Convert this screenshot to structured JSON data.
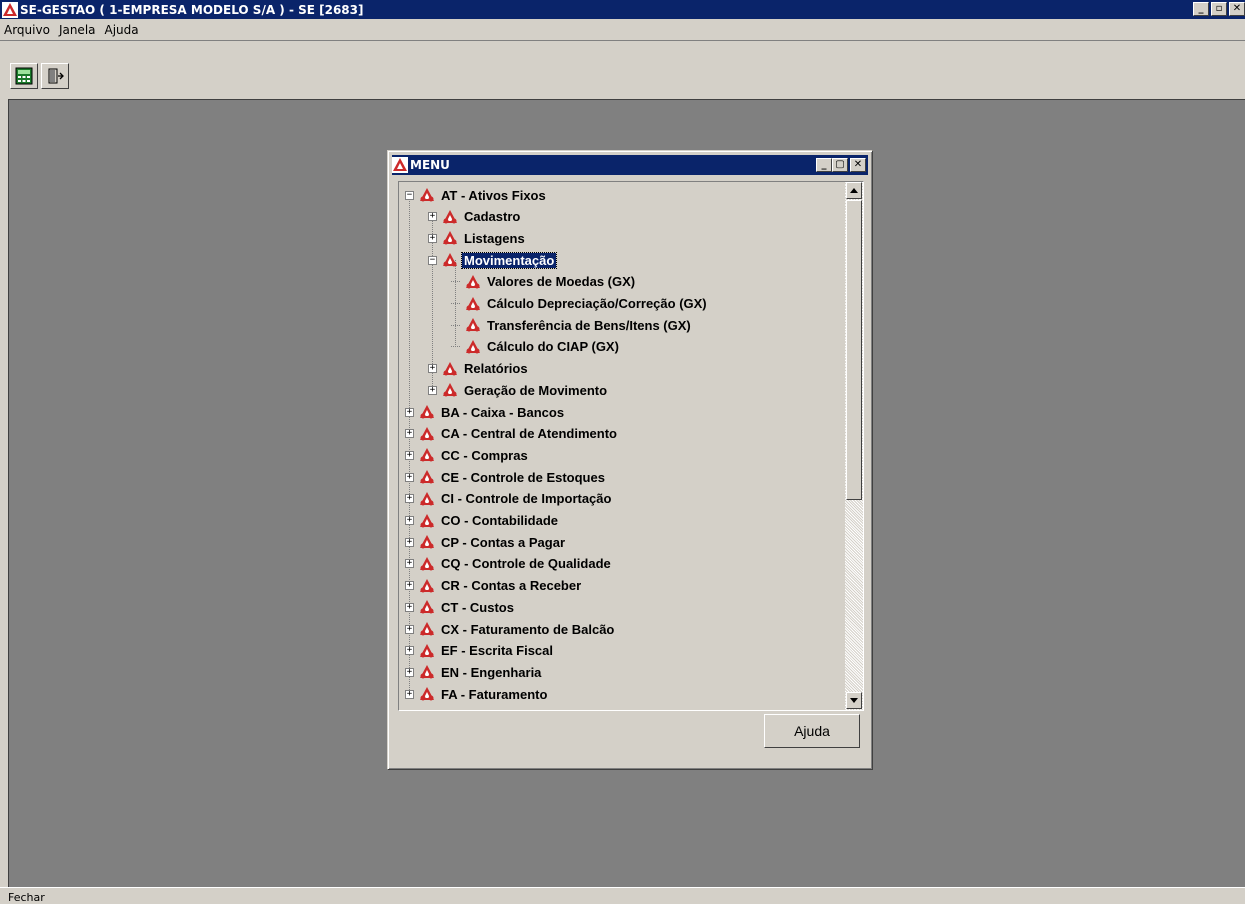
{
  "app": {
    "title": "SE-GESTAO ( 1-EMPRESA MODELO S/A ) - SE [2683]",
    "window_controls": {
      "minimize": "_",
      "restore": "▫",
      "close": "✕"
    }
  },
  "menubar": {
    "items": [
      "Arquivo",
      "Janela",
      "Ajuda"
    ]
  },
  "toolbar": {
    "buttons": [
      {
        "icon": "calculator-icon"
      },
      {
        "icon": "exit-door-icon"
      }
    ]
  },
  "statusbar": {
    "text": "Fechar"
  },
  "menu_window": {
    "title": "MENU",
    "help_button": "Ajuda",
    "tree": [
      {
        "label": "AT - Ativos Fixos",
        "level": 0,
        "expander": "−"
      },
      {
        "label": "Cadastro",
        "level": 1,
        "expander": "+"
      },
      {
        "label": "Listagens",
        "level": 1,
        "expander": "+"
      },
      {
        "label": "Movimentação",
        "level": 1,
        "expander": "−",
        "selected": true
      },
      {
        "label": "Valores de Moedas  (GX)",
        "level": 2,
        "expander": ""
      },
      {
        "label": "Cálculo Depreciação/Correção (GX)",
        "level": 2,
        "expander": ""
      },
      {
        "label": "Transferência de Bens/Itens (GX)",
        "level": 2,
        "expander": ""
      },
      {
        "label": "Cálculo do CIAP (GX)",
        "level": 2,
        "expander": ""
      },
      {
        "label": "Relatórios",
        "level": 1,
        "expander": "+"
      },
      {
        "label": "Geração de Movimento",
        "level": 1,
        "expander": "+"
      },
      {
        "label": "BA - Caixa - Bancos",
        "level": 0,
        "expander": "+"
      },
      {
        "label": "CA - Central de Atendimento",
        "level": 0,
        "expander": "+"
      },
      {
        "label": "CC - Compras",
        "level": 0,
        "expander": "+"
      },
      {
        "label": "CE - Controle de Estoques",
        "level": 0,
        "expander": "+"
      },
      {
        "label": "CI - Controle de Importação",
        "level": 0,
        "expander": "+"
      },
      {
        "label": "CO - Contabilidade",
        "level": 0,
        "expander": "+"
      },
      {
        "label": "CP - Contas a Pagar",
        "level": 0,
        "expander": "+"
      },
      {
        "label": "CQ - Controle de Qualidade",
        "level": 0,
        "expander": "+"
      },
      {
        "label": "CR - Contas a Receber",
        "level": 0,
        "expander": "+"
      },
      {
        "label": "CT - Custos",
        "level": 0,
        "expander": "+"
      },
      {
        "label": "CX - Faturamento de Balcão",
        "level": 0,
        "expander": "+"
      },
      {
        "label": "EF - Escrita Fiscal",
        "level": 0,
        "expander": "+"
      },
      {
        "label": "EN - Engenharia",
        "level": 0,
        "expander": "+"
      },
      {
        "label": "FA - Faturamento",
        "level": 0,
        "expander": "+"
      }
    ],
    "scrollbar": {
      "position": 0.0
    }
  },
  "colors": {
    "titlebar": "#0a246a",
    "face": "#d4d0c8",
    "desktop": "#808080",
    "icon": "#cc2a2a"
  }
}
